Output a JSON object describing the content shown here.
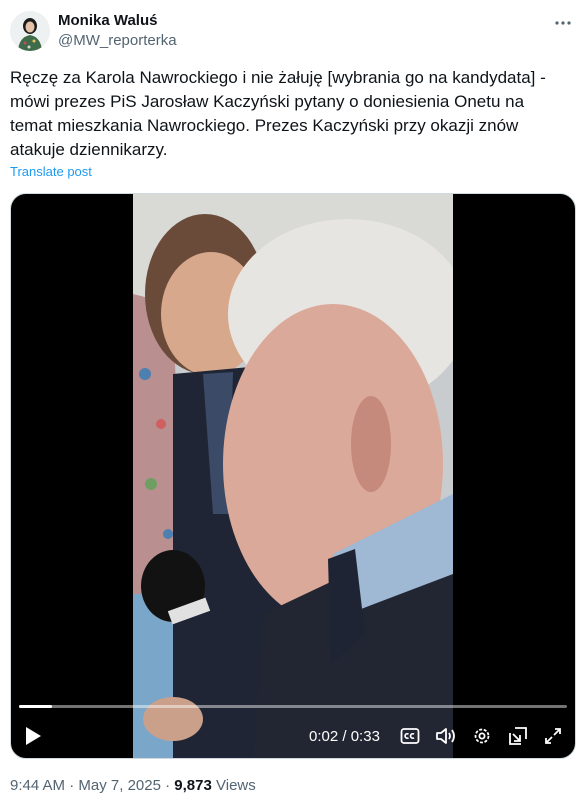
{
  "author": {
    "name": "Monika Waluś",
    "handle": "@MW_reporterka"
  },
  "tweet": {
    "lines": [
      "Ręczę za Karola Nawrockiego i nie żałuję [wybrania go na kandydata] -",
      "mówi prezes PiS Jarosław Kaczyński pytany o doniesienia Onetu na",
      "temat mieszkania Nawrockiego. Prezes Kaczyński przy okazji znów",
      "atakuje dziennikarzy."
    ],
    "translate_label": "Translate post"
  },
  "video": {
    "current_time": "0:02",
    "separator": "/",
    "duration": "0:33",
    "progress_fraction": 0.061
  },
  "meta": {
    "time": "9:44 AM",
    "dot": "·",
    "date": "May 7, 2025",
    "views_count": "9,873",
    "views_label": "Views"
  },
  "icons": {
    "more": "more-horizontal-icon",
    "play": "play-icon",
    "captions": "closed-captions-icon",
    "volume": "volume-icon",
    "settings": "settings-gear-icon",
    "pip": "picture-in-picture-icon",
    "fullscreen": "fullscreen-icon"
  },
  "colors": {
    "link": "#1d9bf0",
    "secondary_text": "#536471",
    "primary_text": "#0f1419"
  }
}
